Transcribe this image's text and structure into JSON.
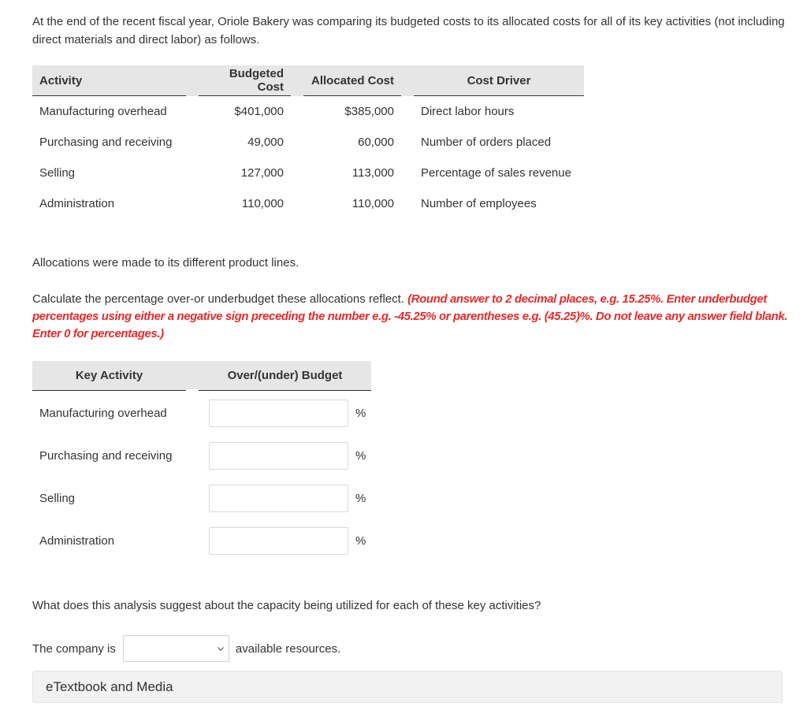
{
  "intro": "At the end of the recent fiscal year, Oriole Bakery was comparing its budgeted costs to its allocated costs for all of its key activities (not including direct materials and direct labor) as follows.",
  "cost_table": {
    "headers": [
      "Activity",
      "Budgeted Cost",
      "Allocated Cost",
      "Cost Driver"
    ],
    "rows": [
      {
        "activity": "Manufacturing overhead",
        "budgeted": "$401,000",
        "allocated": "$385,000",
        "driver": "Direct labor hours"
      },
      {
        "activity": "Purchasing and receiving",
        "budgeted": "49,000",
        "allocated": "60,000",
        "driver": "Number of orders placed"
      },
      {
        "activity": "Selling",
        "budgeted": "127,000",
        "allocated": "113,000",
        "driver": "Percentage of sales revenue"
      },
      {
        "activity": "Administration",
        "budgeted": "110,000",
        "allocated": "110,000",
        "driver": "Number of employees"
      }
    ]
  },
  "allocations_text": "Allocations were made to its different product lines.",
  "instruction": {
    "text": "Calculate the percentage over-or underbudget these allocations reflect.",
    "note": "(Round answer to 2 decimal places, e.g. 15.25%. Enter underbudget percentages using either a negative sign preceding the number e.g. -45.25% or parentheses e.g. (45.25)%. Do not leave any answer field blank. Enter 0 for percentages.)"
  },
  "answer_table": {
    "headers": [
      "Key Activity",
      "Over/(under) Budget"
    ],
    "unit": "%",
    "rows": [
      {
        "activity": "Manufacturing overhead",
        "value": ""
      },
      {
        "activity": "Purchasing and receiving",
        "value": ""
      },
      {
        "activity": "Selling",
        "value": ""
      },
      {
        "activity": "Administration",
        "value": ""
      }
    ]
  },
  "question2": "What does this analysis suggest about the capacity being utilized for each of these key activities?",
  "company_line": {
    "prefix": "The company is",
    "selected": "",
    "suffix": "available resources."
  },
  "etextbook": "eTextbook and Media"
}
